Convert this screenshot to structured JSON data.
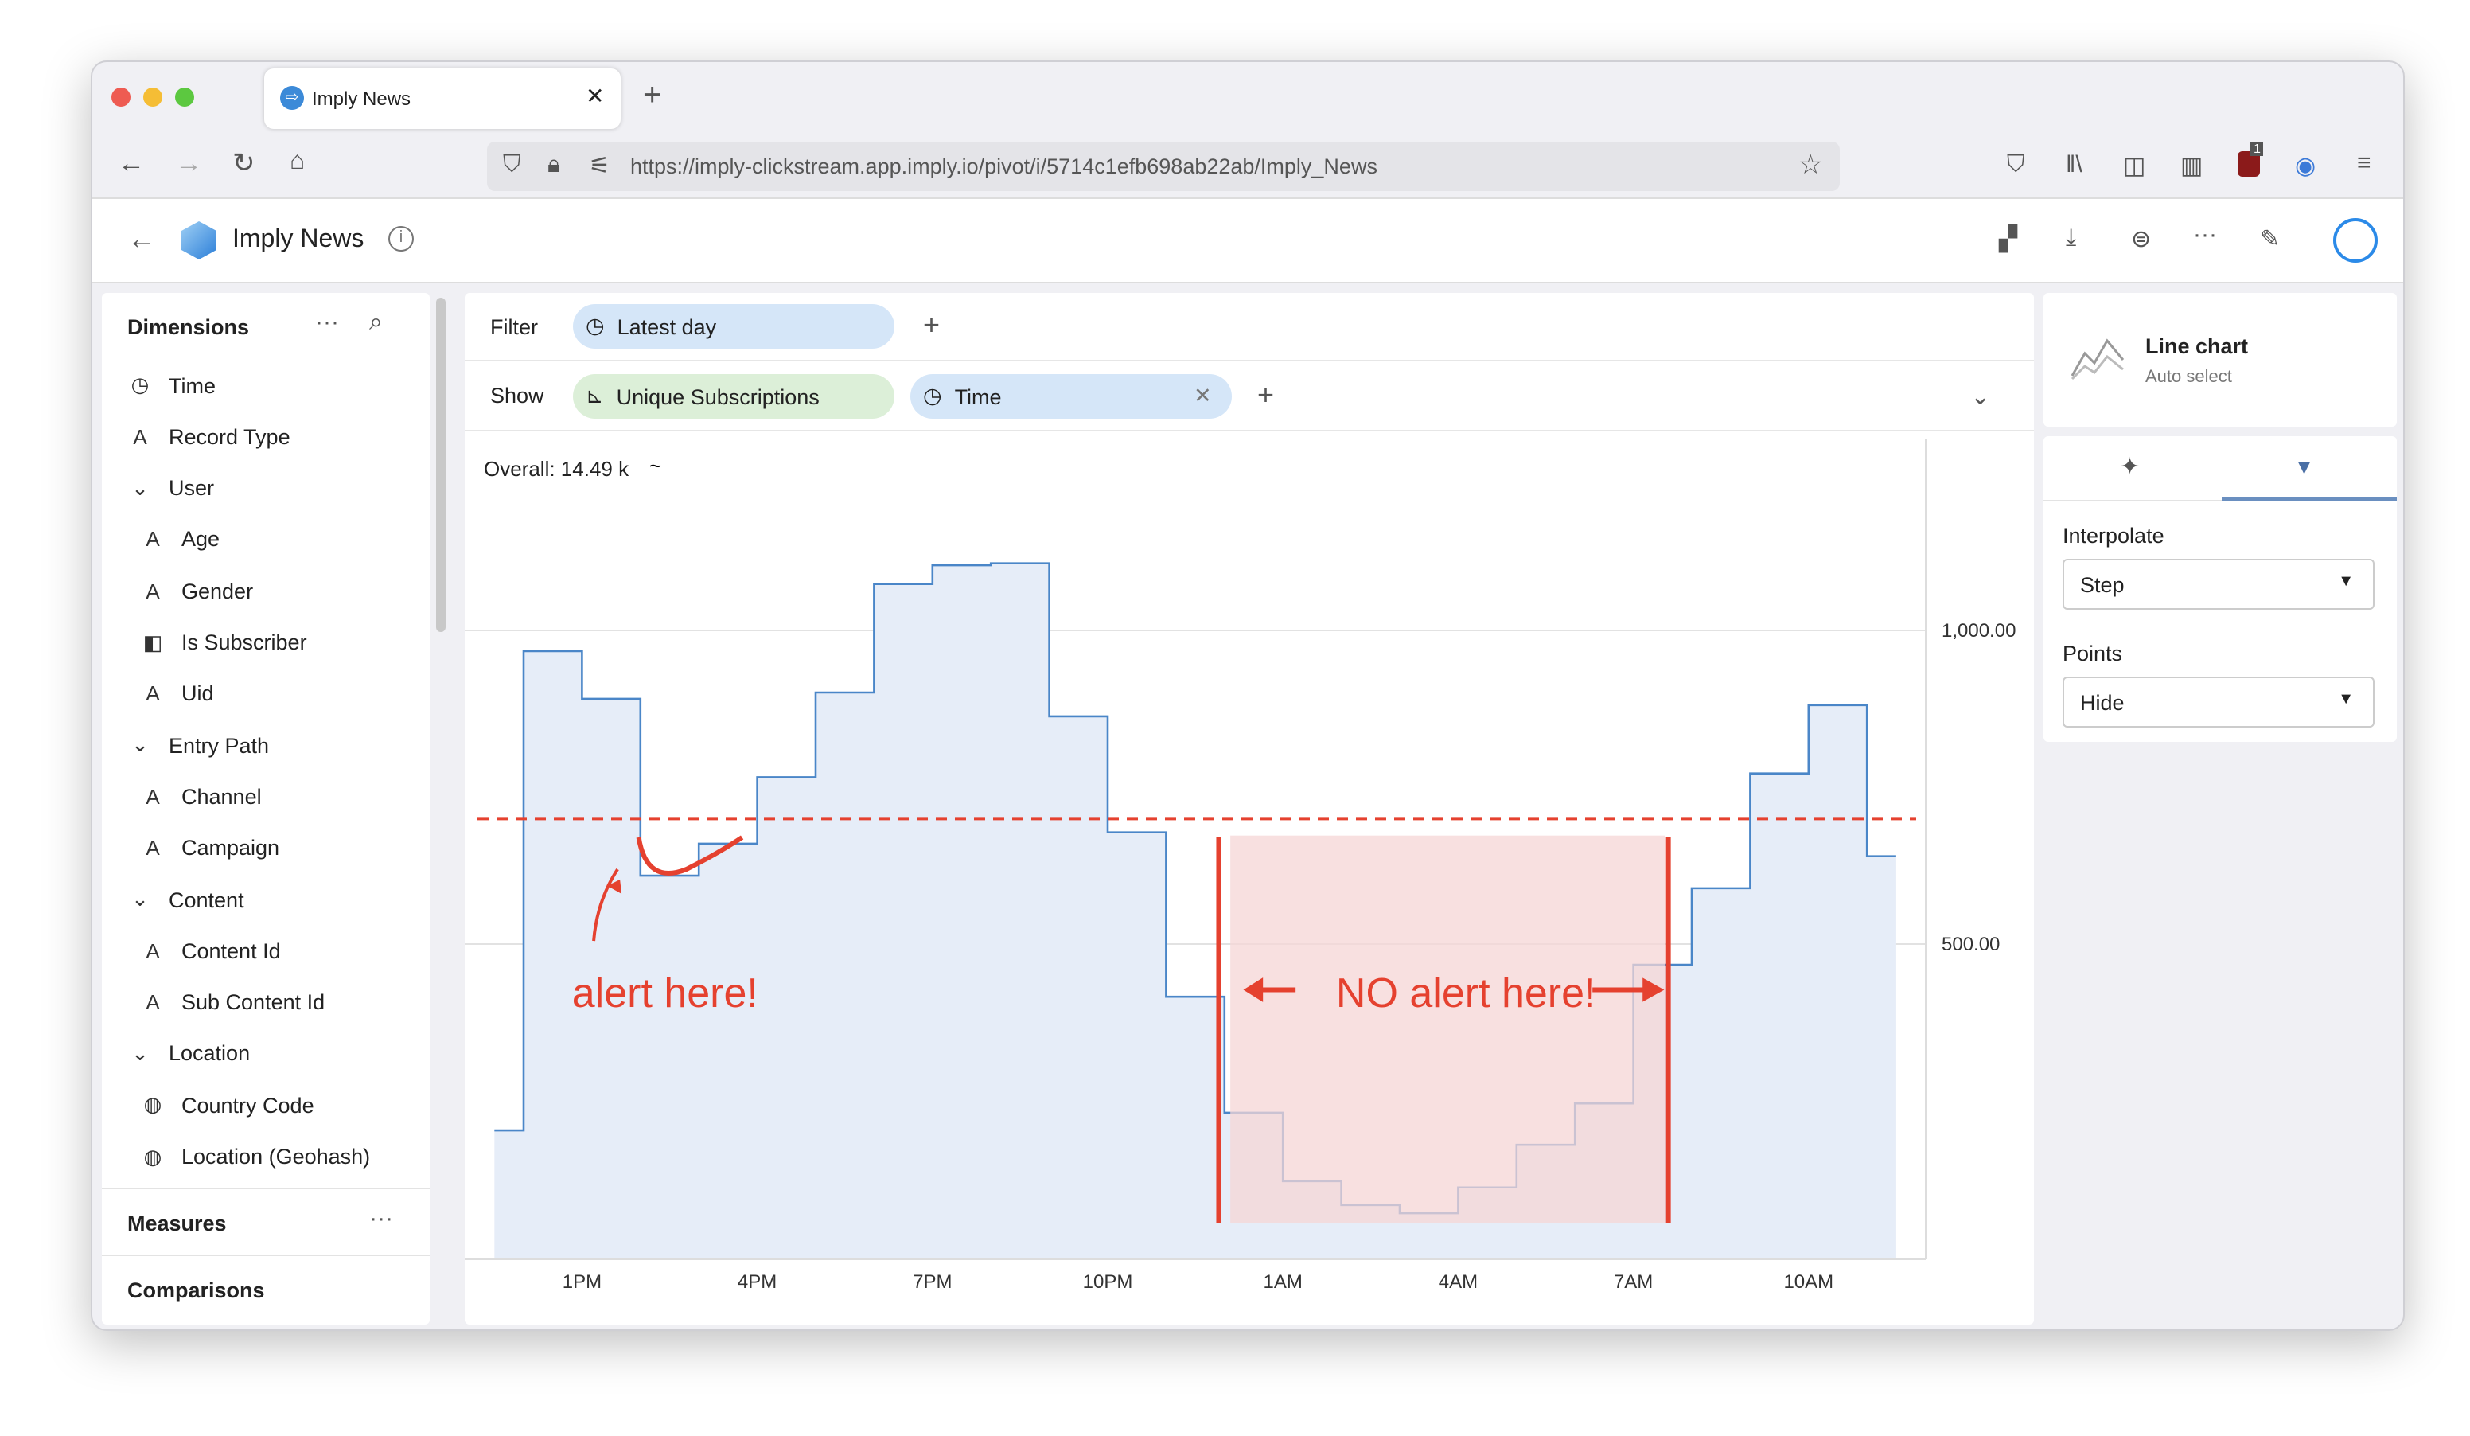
{
  "browser": {
    "tab_title": "Imply News",
    "url": "https://imply-clickstream.app.imply.io/pivot/i/5714c1efb698ab22ab/Imply_News",
    "notification_badge": "1"
  },
  "app": {
    "title": "Imply News"
  },
  "sidebar": {
    "dimensions_title": "Dimensions",
    "measures_title": "Measures",
    "comparisons_title": "Comparisons",
    "items": [
      {
        "label": "Time",
        "icon": "clock-icon",
        "indent": 0
      },
      {
        "label": "Record Type",
        "icon": "string-icon",
        "indent": 0
      },
      {
        "label": "User",
        "icon": "chevron-down-icon",
        "indent": 0
      },
      {
        "label": "Age",
        "icon": "string-icon",
        "indent": 1
      },
      {
        "label": "Gender",
        "icon": "string-icon",
        "indent": 1
      },
      {
        "label": "Is Subscriber",
        "icon": "boolean-icon",
        "indent": 1
      },
      {
        "label": "Uid",
        "icon": "string-icon",
        "indent": 1
      },
      {
        "label": "Entry Path",
        "icon": "chevron-down-icon",
        "indent": 0
      },
      {
        "label": "Channel",
        "icon": "string-icon",
        "indent": 1
      },
      {
        "label": "Campaign",
        "icon": "string-icon",
        "indent": 1
      },
      {
        "label": "Content",
        "icon": "chevron-down-icon",
        "indent": 0
      },
      {
        "label": "Content Id",
        "icon": "string-icon",
        "indent": 1
      },
      {
        "label": "Sub Content Id",
        "icon": "string-icon",
        "indent": 1
      },
      {
        "label": "Location",
        "icon": "chevron-down-icon",
        "indent": 0
      },
      {
        "label": "Country Code",
        "icon": "globe-icon",
        "indent": 1
      },
      {
        "label": "Location (Geohash)",
        "icon": "globe-icon",
        "indent": 1
      }
    ]
  },
  "filter": {
    "label": "Filter",
    "pill": "Latest day"
  },
  "show": {
    "label": "Show",
    "measure": "Unique Subscriptions",
    "split": "Time"
  },
  "viz": {
    "name": "Line chart",
    "sub": "Auto select",
    "interpolate_label": "Interpolate",
    "interpolate_value": "Step",
    "points_label": "Points",
    "points_value": "Hide"
  },
  "colors": {
    "accent": "#4a86c8",
    "fill": "#e6edf8",
    "threshold": "#e5412f",
    "annotation_box": "#f5d5d5"
  },
  "chart_data": {
    "type": "line",
    "interpolation": "step",
    "overall": "Overall: 14.49 k",
    "x": [
      "11:30 AM",
      "12 PM",
      "1 PM",
      "2 PM",
      "3 PM",
      "4 PM",
      "5 PM",
      "6 PM",
      "7 PM",
      "8 PM",
      "9 PM",
      "10 PM",
      "11 PM",
      "12 AM",
      "1 AM",
      "2 AM",
      "3 AM",
      "4 AM",
      "5 AM",
      "6 AM",
      "7 AM",
      "8 AM",
      "9 AM",
      "10 AM",
      "11 AM"
    ],
    "values": [
      203,
      967,
      891,
      609,
      660,
      766,
      901,
      1074,
      1104,
      1107,
      863,
      678,
      416,
      231,
      122,
      84,
      71,
      112,
      180,
      246,
      467,
      589,
      772,
      881,
      640
    ],
    "x_ticks": [
      "1PM",
      "4PM",
      "7PM",
      "10PM",
      "1AM",
      "4AM",
      "7AM",
      "10AM"
    ],
    "y_ticks": [
      "500.00",
      "1,000.00"
    ],
    "ylim": [
      0,
      1200
    ],
    "grid": true,
    "threshold": 700,
    "annotations": {
      "alert": "alert here!",
      "no_alert": "NO alert here!"
    }
  }
}
